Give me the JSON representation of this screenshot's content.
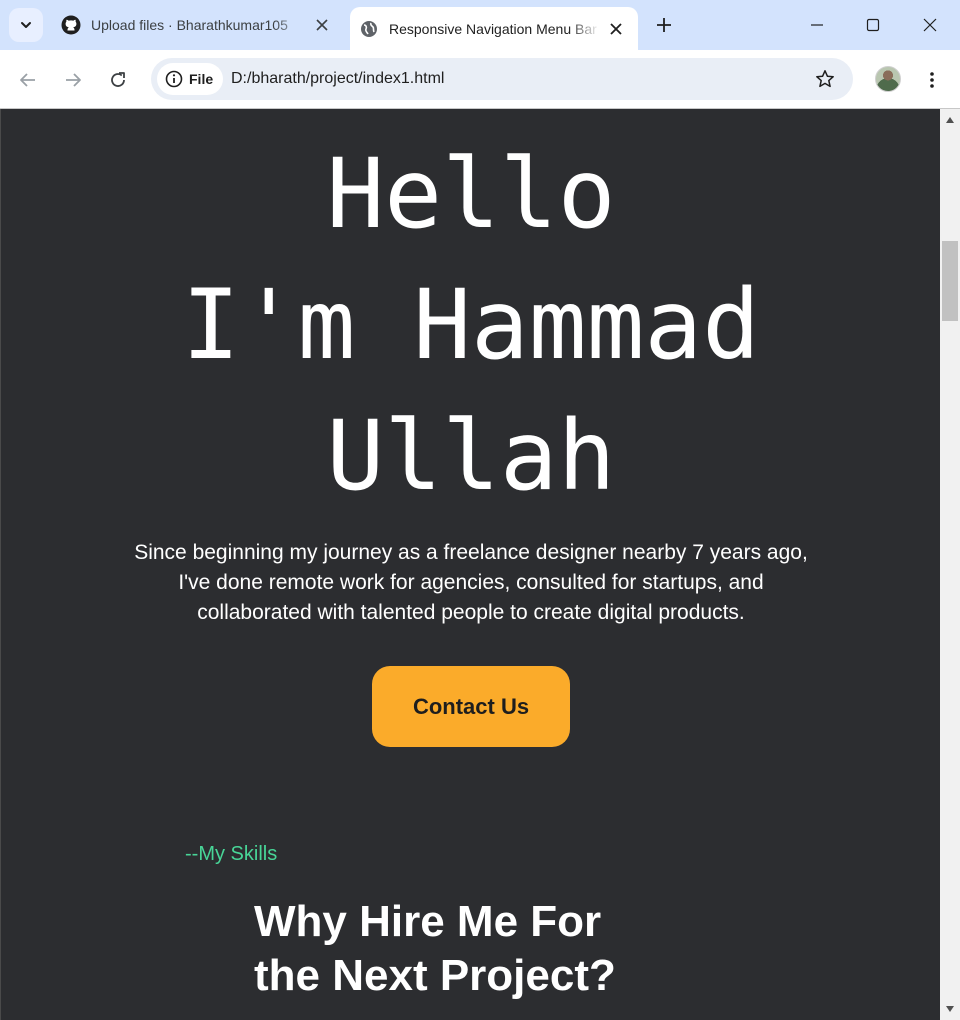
{
  "browser": {
    "tabs": [
      {
        "title": "Upload files · Bharathkumar105",
        "favicon": "github-icon",
        "active": false
      },
      {
        "title": "Responsive Navigation Menu Bar",
        "favicon": "globe-icon",
        "active": true
      }
    ],
    "address": {
      "chip_label": "File",
      "url": "D:/bharath/project/index1.html"
    }
  },
  "page": {
    "hero": {
      "line1": "Hello",
      "line2": "I'm Hammad",
      "line3": "Ullah",
      "description": "Since beginning my journey as a freelance designer nearby 7 years ago, I've done remote work for agencies, consulted for startups, and collaborated with talented people to create digital products.",
      "cta_label": "Contact Us"
    },
    "skills": {
      "label": "--My Skills",
      "heading": "Why Hire Me For the Next Project?"
    }
  },
  "colors": {
    "page_bg": "#2c2d30",
    "accent_button": "#fbab2a",
    "skills_label": "#48d597",
    "tabstrip_bg": "#d3e3fd"
  }
}
